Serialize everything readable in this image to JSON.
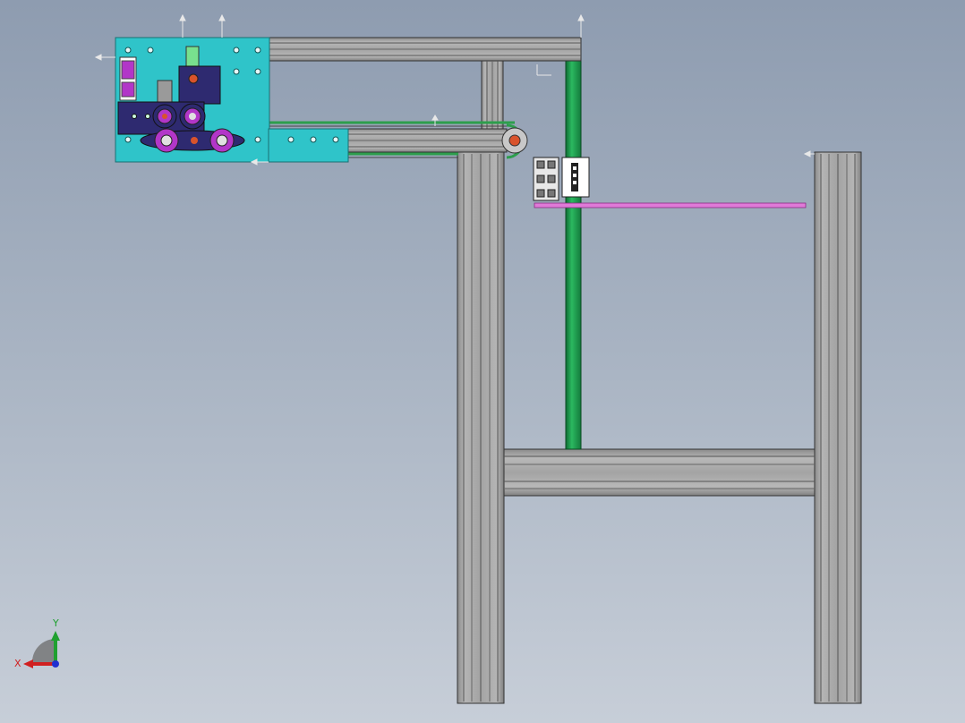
{
  "scene": {
    "background_top": "#8e9cb0",
    "background_bottom": "#c7ced8",
    "colors": {
      "aluminum": "#a6a6a6",
      "aluminum_dark": "#7d7d7d",
      "plate": "#2fc4c9",
      "shaft": "#1e9a4e",
      "rod": "#e07ad8",
      "motor": "#2e2a70",
      "bearing": "#b236c8",
      "sensor": "#ffffff",
      "hub": "#d9532b"
    }
  },
  "triad": {
    "x_label": "X",
    "y_label": "Y",
    "x_color": "#d02020",
    "y_color": "#20a030",
    "z_color": "#2030d0"
  }
}
